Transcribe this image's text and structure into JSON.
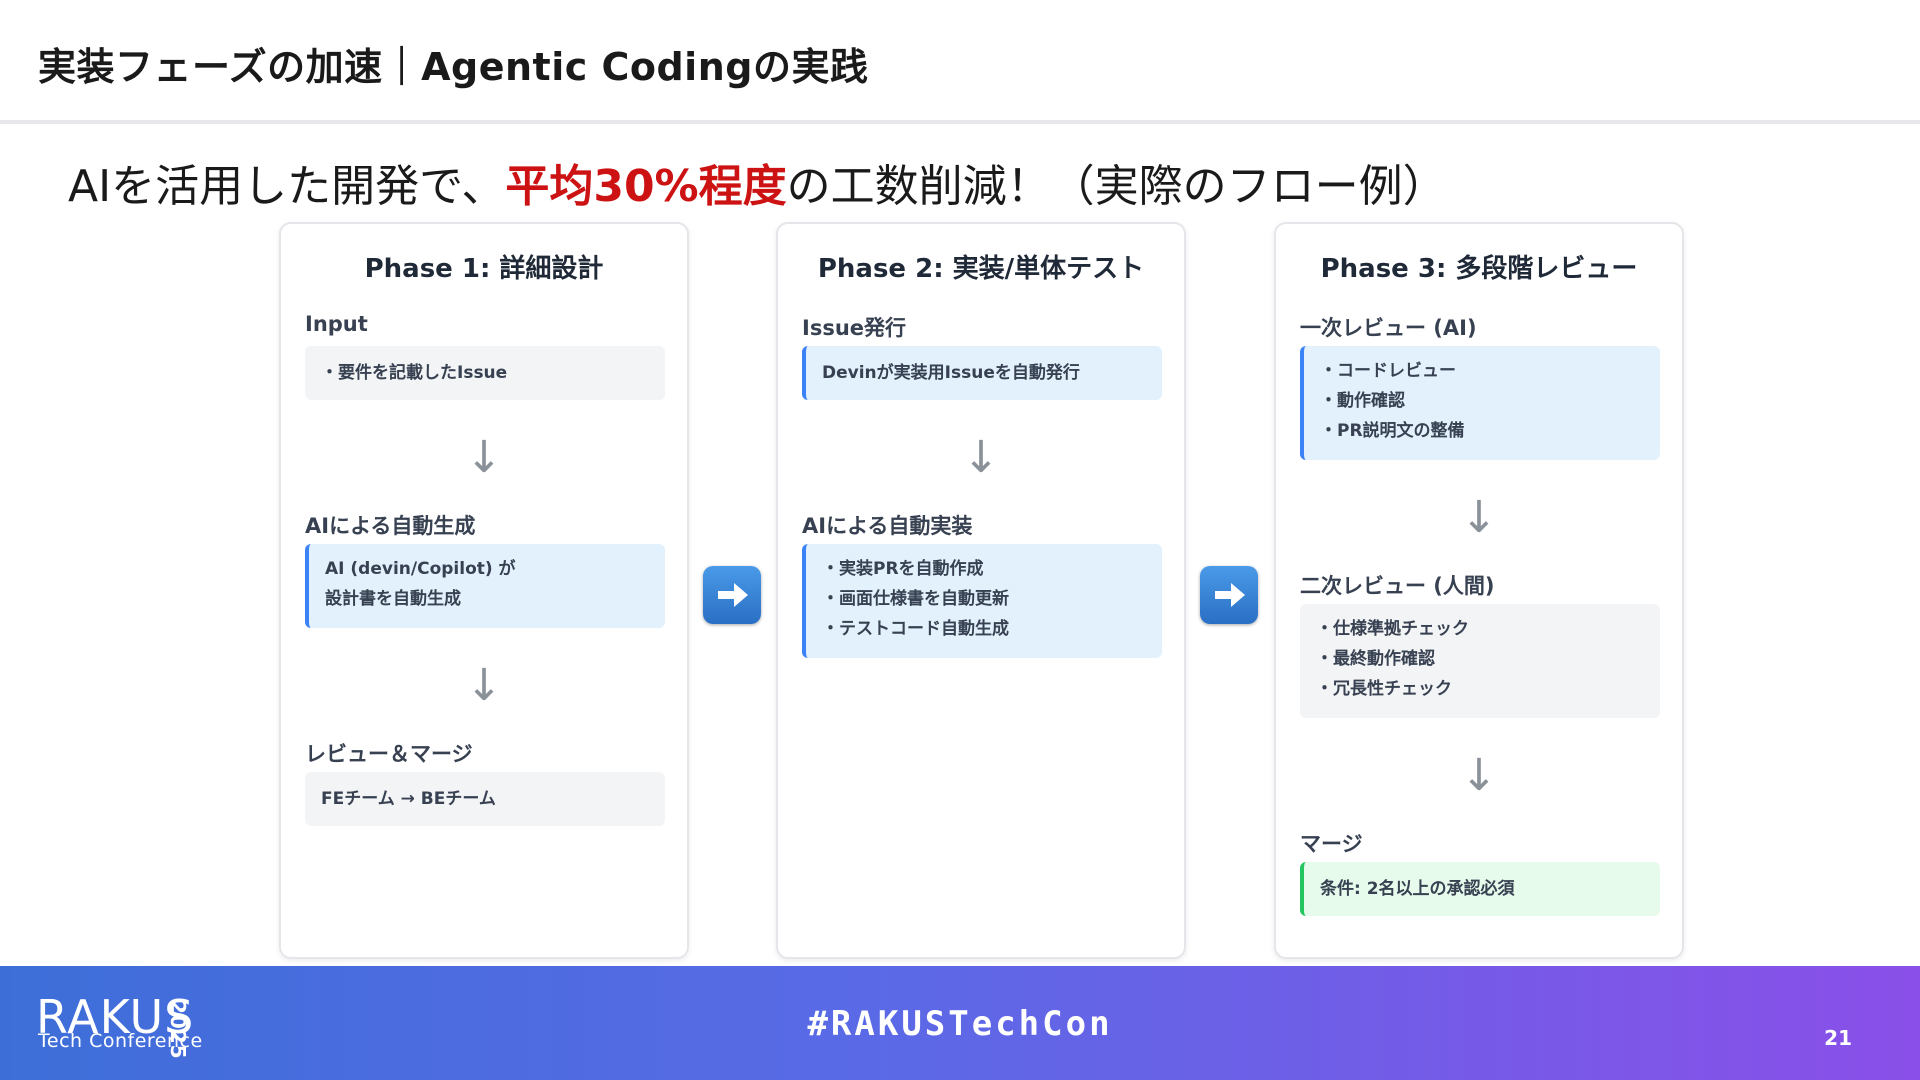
{
  "slide": {
    "title": "実装フェーズの加速｜Agentic Codingの実践",
    "headline": {
      "prefix": "AIを活用した開発で、",
      "accent": "平均30%程度",
      "suffix": "の工数削減！（実際のフロー例）"
    }
  },
  "phases": [
    {
      "title": "Phase 1: 詳細設計",
      "steps": [
        {
          "label": "Input",
          "lines": [
            "・要件を記載したIssue"
          ]
        },
        {
          "label": "AIによる自動生成",
          "lines": [
            "AI (devin/Copilot) が",
            "設計書を自動生成"
          ]
        },
        {
          "label": "レビュー＆マージ",
          "lines": [
            "FEチーム → BEチーム"
          ]
        }
      ]
    },
    {
      "title": "Phase 2: 実装/単体テスト",
      "steps": [
        {
          "label": "Issue発行",
          "lines": [
            "Devinが実装用Issueを自動発行"
          ]
        },
        {
          "label": "AIによる自動実装",
          "lines": [
            "・実装PRを自動作成",
            "・画面仕様書を自動更新",
            "・テストコード自動生成"
          ]
        }
      ]
    },
    {
      "title": "Phase 3: 多段階レビュー",
      "steps": [
        {
          "label": "一次レビュー (AI)",
          "lines": [
            "・コードレビュー",
            "・動作確認",
            "・PR説明文の整備"
          ]
        },
        {
          "label": "二次レビュー (人間)",
          "lines": [
            "・仕様準拠チェック",
            "・最終動作確認",
            "・冗長性チェック"
          ]
        },
        {
          "label": "マージ",
          "lines": [
            "条件: 2名以上の承認必須"
          ]
        }
      ]
    }
  ],
  "arrows": {
    "down": "↓",
    "between_icon": "right-arrow-icon"
  },
  "footer": {
    "logo_text": "RAKUS",
    "logo_year": "2025",
    "logo_sub": "Tech Conference",
    "hashtag": "#RAKUSTechCon",
    "page_number": "21"
  },
  "colors": {
    "accent_red": "#cc1212",
    "info_blue": "#3b82f6",
    "success_green": "#22c55e",
    "footer_start": "#3d6ed8",
    "footer_end": "#8a4fe8"
  }
}
